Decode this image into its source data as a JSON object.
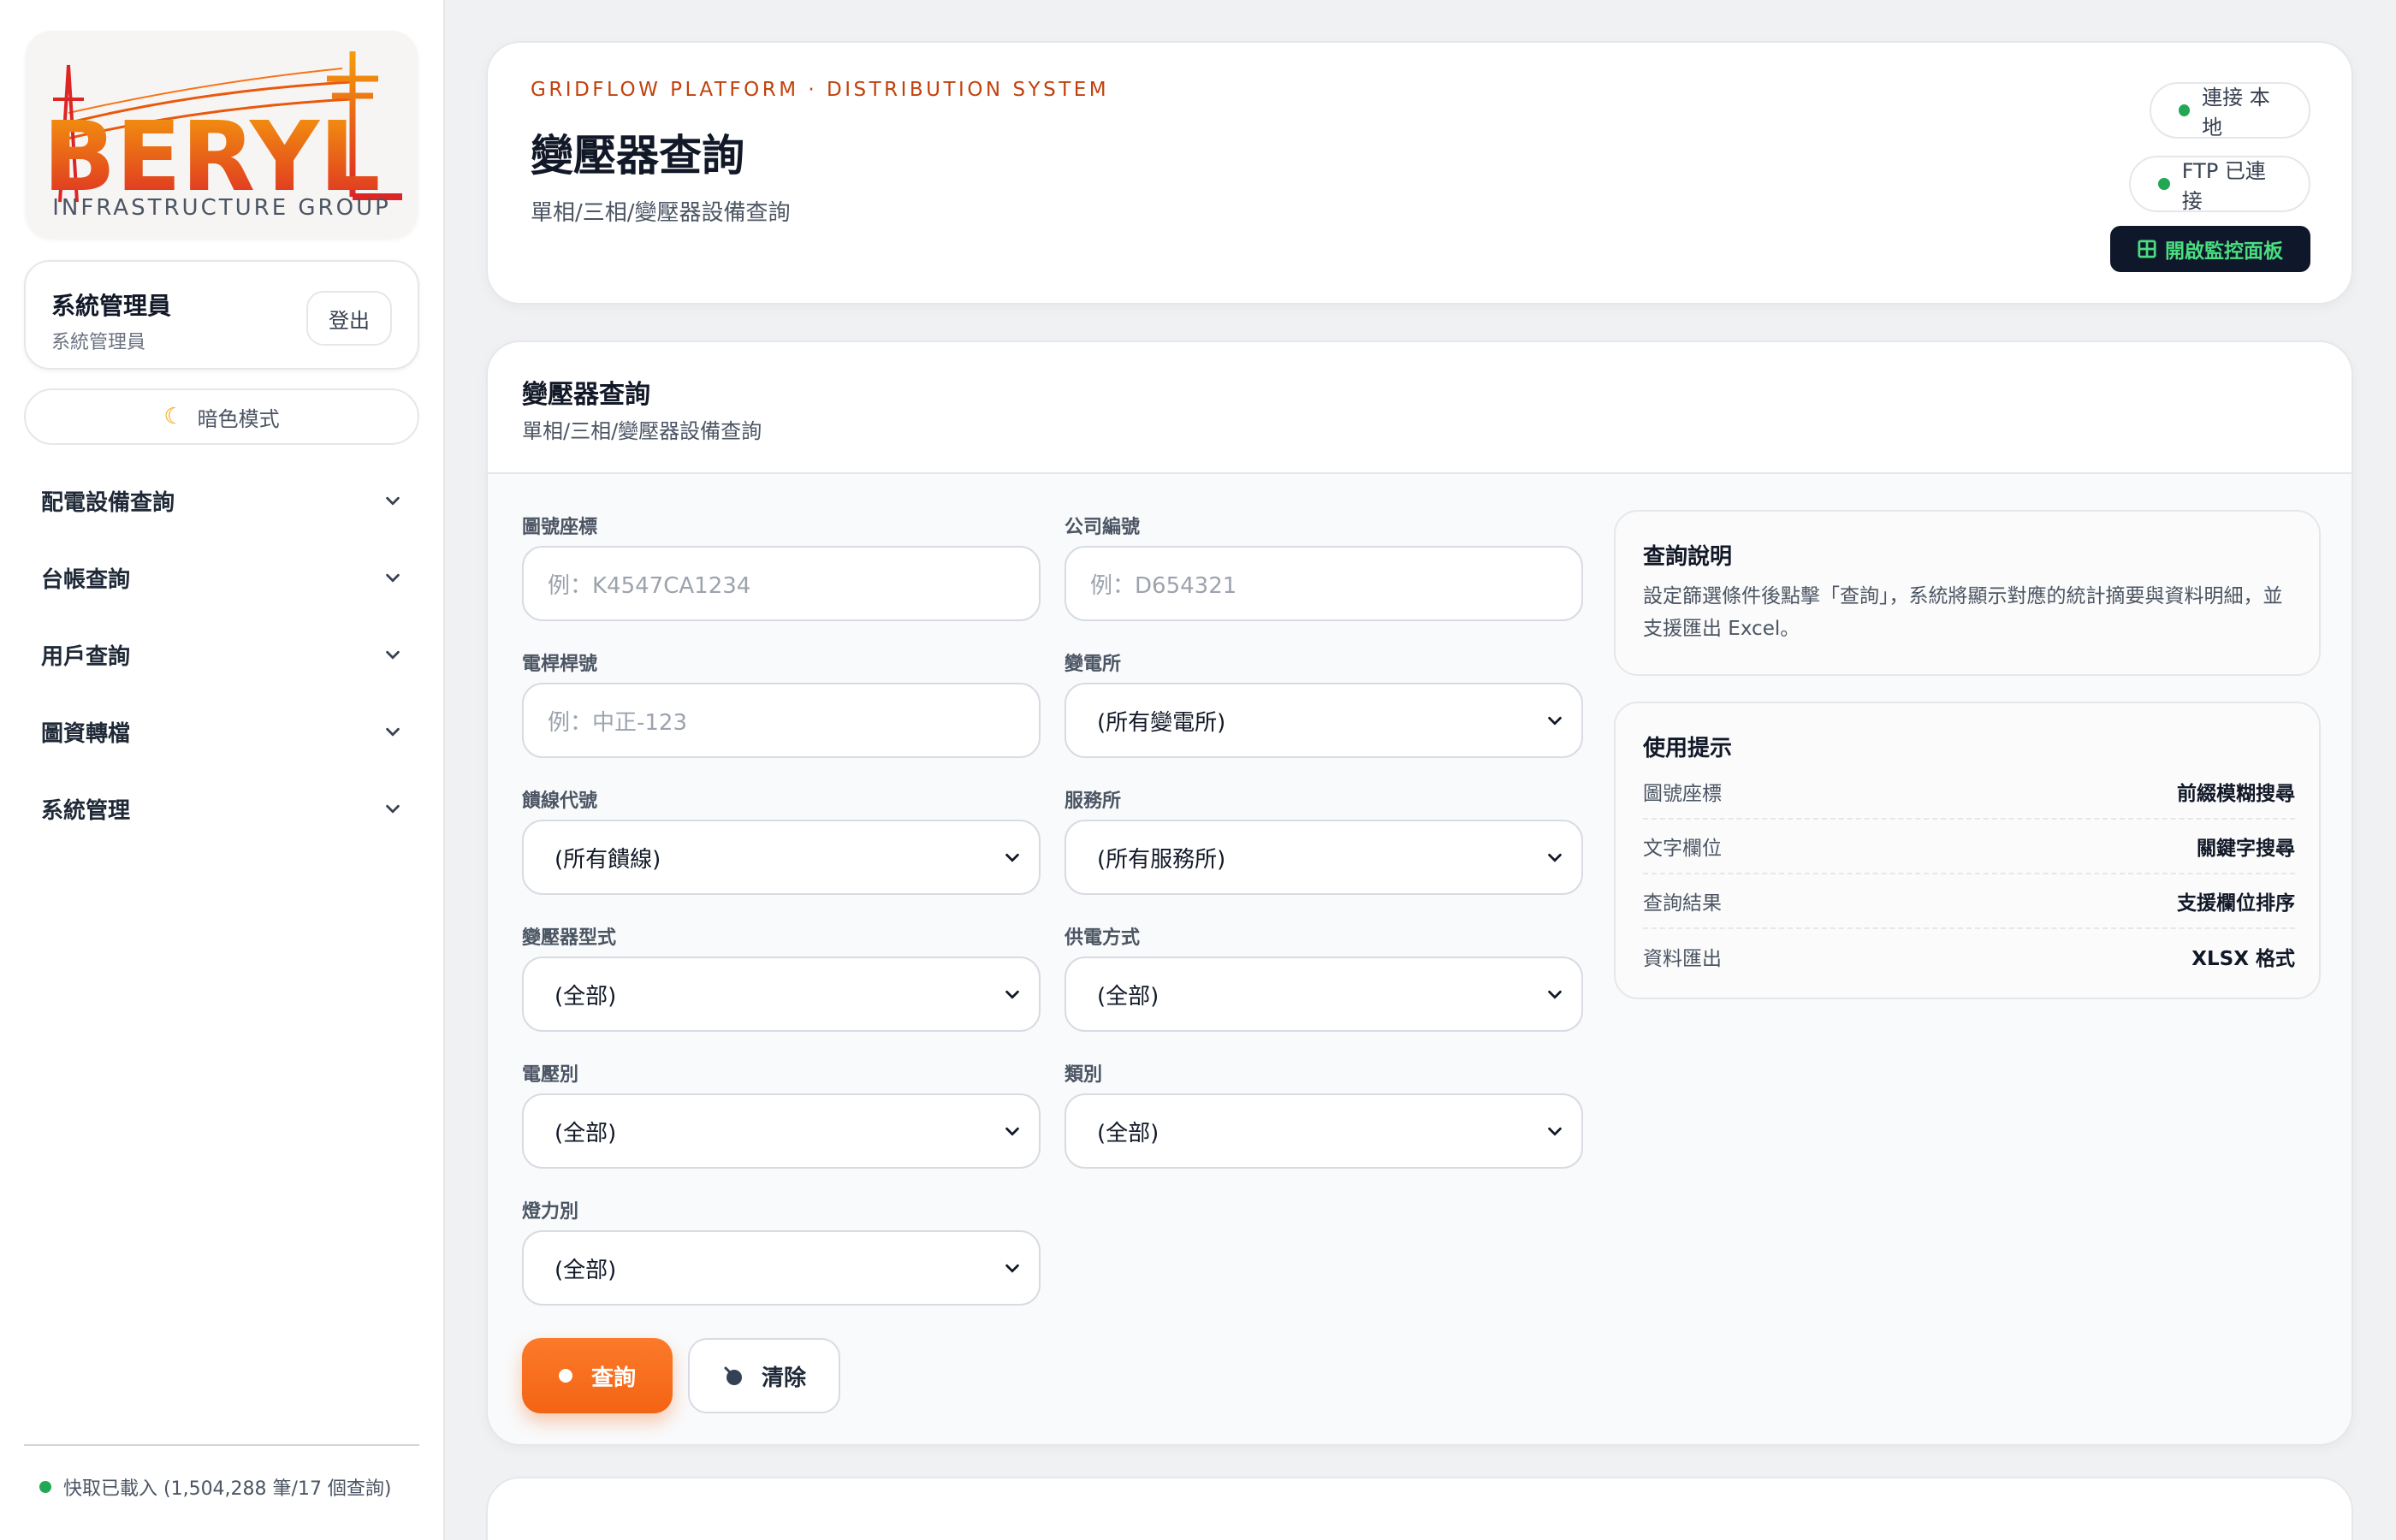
{
  "brand": {
    "logo_text": "BERYL",
    "logo_subtitle": "INFRASTRUCTURE GROUP",
    "colors": {
      "accent": "#f36414",
      "logo_orange": "#ea580c",
      "logo_red": "#dc2626"
    }
  },
  "user": {
    "name": "系統管理員",
    "role": "系統管理員",
    "logout_label": "登出"
  },
  "theme_toggle": {
    "label": "暗色模式",
    "icon": "moon-icon"
  },
  "sidebar": {
    "items": [
      {
        "label": "配電設備查詢"
      },
      {
        "label": "台帳查詢"
      },
      {
        "label": "用戶查詢"
      },
      {
        "label": "圖資轉檔"
      },
      {
        "label": "系統管理"
      }
    ],
    "cache_status": "快取已載入 (1,504,288 筆/17 個查詢)"
  },
  "header": {
    "kicker": "GRIDFLOW PLATFORM · DISTRIBUTION SYSTEM",
    "title": "變壓器查詢",
    "subtitle": "單相/三相/變壓器設備查詢",
    "status_local": "連接 本地",
    "status_ftp": "FTP 已連接",
    "monitor_button": "開啟監控面板"
  },
  "query": {
    "title": "變壓器查詢",
    "subtitle": "單相/三相/變壓器設備查詢",
    "fields": {
      "map_coord": {
        "label": "圖號座標",
        "placeholder": "例：K4547CA1234"
      },
      "company_no": {
        "label": "公司編號",
        "placeholder": "例：D654321"
      },
      "pole_no": {
        "label": "電桿桿號",
        "placeholder": "例：中正-123"
      },
      "substation": {
        "label": "變電所",
        "value": "(所有變電所)"
      },
      "feeder": {
        "label": "饋線代號",
        "value": "(所有饋線)"
      },
      "service_office": {
        "label": "服務所",
        "value": "(所有服務所)"
      },
      "transformer_type": {
        "label": "變壓器型式",
        "value": "(全部)"
      },
      "supply_method": {
        "label": "供電方式",
        "value": "(全部)"
      },
      "voltage": {
        "label": "電壓別",
        "value": "(全部)"
      },
      "category": {
        "label": "類別",
        "value": "(全部)"
      },
      "light_power": {
        "label": "燈力別",
        "value": "(全部)"
      }
    },
    "query_button": "查詢",
    "clear_button": "清除"
  },
  "help": {
    "title": "查詢說明",
    "text": "設定篩選條件後點擊「查詢」，系統將顯示對應的統計摘要與資料明細，並支援匯出 Excel。"
  },
  "tips": {
    "title": "使用提示",
    "rows": [
      {
        "key": "圖號座標",
        "value": "前綴模糊搜尋"
      },
      {
        "key": "文字欄位",
        "value": "關鍵字搜尋"
      },
      {
        "key": "查詢結果",
        "value": "支援欄位排序"
      },
      {
        "key": "資料匯出",
        "value": "XLSX 格式"
      }
    ]
  }
}
